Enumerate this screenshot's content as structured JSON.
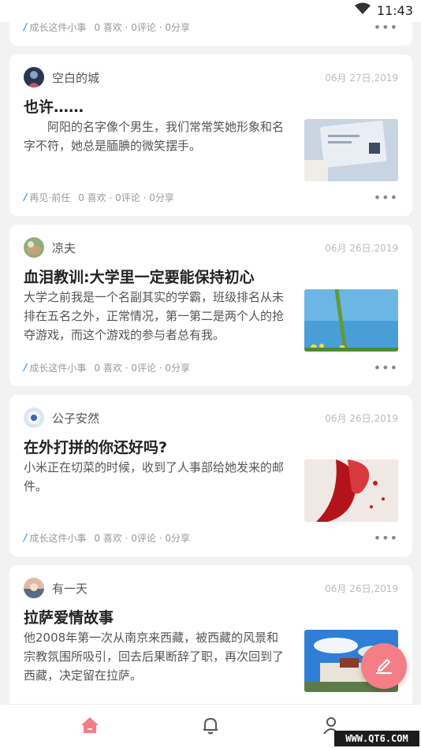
{
  "status_bar": {
    "time": "11:43"
  },
  "top_card_partial": {
    "tag": "成长这件小事",
    "stats": "0 喜欢 · 0评论 · 0分享",
    "more": "•••"
  },
  "posts": [
    {
      "author": "空白的城",
      "date": "06月 27日,2019",
      "title": "也许……",
      "excerpt": "阿阳的名字像个男生，我们常常笑她形象和名字不符，她总是腼腆的微笑摆手。",
      "tag": "再见·前任",
      "stats": "0 喜欢 · 0评论 · 0分享",
      "more": "•••"
    },
    {
      "author": "凉夫",
      "date": "06月 26日,2019",
      "title": "血泪教训:大学里一定要能保持初心",
      "excerpt": "大学之前我是一个名副其实的学霸，班级排名从未排在五名之外，正常情况，第一第二是两个人的抢夺游戏，而这个游戏的参与者总有我。",
      "tag": "成长这件小事",
      "stats": "0 喜欢 · 0评论 · 0分享",
      "more": "•••"
    },
    {
      "author": "公子安然",
      "date": "06月 26日,2019",
      "title": "在外打拼的你还好吗?",
      "excerpt": "小米正在切菜的时候，收到了人事部给她发来的邮件。",
      "tag": "成长这件小事",
      "stats": "0 喜欢 · 0评论 · 0分享",
      "more": "•••"
    },
    {
      "author": "有一天",
      "date": "06月 26日,2019",
      "title": "拉萨爱情故事",
      "excerpt": "他2008年第一次从南京来西藏，被西藏的风景和宗教氛围所吸引，回去后果断辞了职，再次回到了西藏，决定留在拉萨。"
    }
  ],
  "watermark": "WWW.QT6.COM",
  "icons": {
    "fab": "pencil-icon",
    "tabs": [
      "home-icon",
      "bell-icon",
      "user-icon"
    ]
  },
  "colors": {
    "accent": "#f47d86",
    "tag": "#3aa0e0"
  }
}
